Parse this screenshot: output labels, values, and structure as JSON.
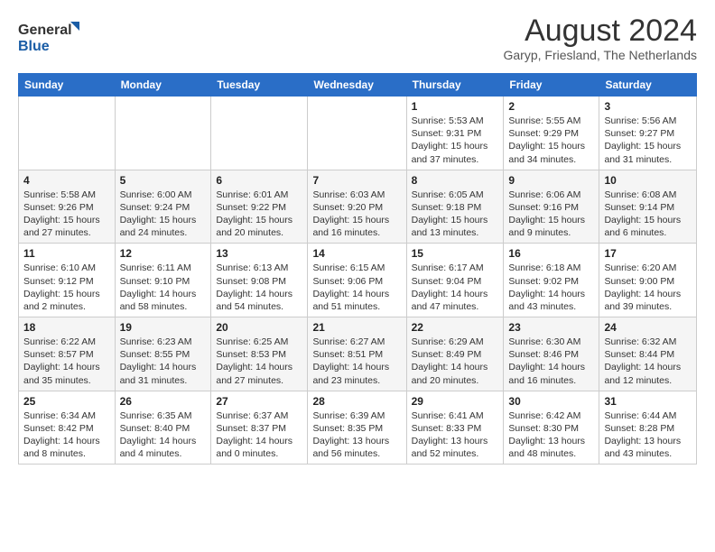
{
  "header": {
    "logo_general": "General",
    "logo_blue": "Blue",
    "main_title": "August 2024",
    "subtitle": "Garyp, Friesland, The Netherlands"
  },
  "weekdays": [
    "Sunday",
    "Monday",
    "Tuesday",
    "Wednesday",
    "Thursday",
    "Friday",
    "Saturday"
  ],
  "weeks": [
    [
      {
        "day": "",
        "info": ""
      },
      {
        "day": "",
        "info": ""
      },
      {
        "day": "",
        "info": ""
      },
      {
        "day": "",
        "info": ""
      },
      {
        "day": "1",
        "info": "Sunrise: 5:53 AM\nSunset: 9:31 PM\nDaylight: 15 hours\nand 37 minutes."
      },
      {
        "day": "2",
        "info": "Sunrise: 5:55 AM\nSunset: 9:29 PM\nDaylight: 15 hours\nand 34 minutes."
      },
      {
        "day": "3",
        "info": "Sunrise: 5:56 AM\nSunset: 9:27 PM\nDaylight: 15 hours\nand 31 minutes."
      }
    ],
    [
      {
        "day": "4",
        "info": "Sunrise: 5:58 AM\nSunset: 9:26 PM\nDaylight: 15 hours\nand 27 minutes."
      },
      {
        "day": "5",
        "info": "Sunrise: 6:00 AM\nSunset: 9:24 PM\nDaylight: 15 hours\nand 24 minutes."
      },
      {
        "day": "6",
        "info": "Sunrise: 6:01 AM\nSunset: 9:22 PM\nDaylight: 15 hours\nand 20 minutes."
      },
      {
        "day": "7",
        "info": "Sunrise: 6:03 AM\nSunset: 9:20 PM\nDaylight: 15 hours\nand 16 minutes."
      },
      {
        "day": "8",
        "info": "Sunrise: 6:05 AM\nSunset: 9:18 PM\nDaylight: 15 hours\nand 13 minutes."
      },
      {
        "day": "9",
        "info": "Sunrise: 6:06 AM\nSunset: 9:16 PM\nDaylight: 15 hours\nand 9 minutes."
      },
      {
        "day": "10",
        "info": "Sunrise: 6:08 AM\nSunset: 9:14 PM\nDaylight: 15 hours\nand 6 minutes."
      }
    ],
    [
      {
        "day": "11",
        "info": "Sunrise: 6:10 AM\nSunset: 9:12 PM\nDaylight: 15 hours\nand 2 minutes."
      },
      {
        "day": "12",
        "info": "Sunrise: 6:11 AM\nSunset: 9:10 PM\nDaylight: 14 hours\nand 58 minutes."
      },
      {
        "day": "13",
        "info": "Sunrise: 6:13 AM\nSunset: 9:08 PM\nDaylight: 14 hours\nand 54 minutes."
      },
      {
        "day": "14",
        "info": "Sunrise: 6:15 AM\nSunset: 9:06 PM\nDaylight: 14 hours\nand 51 minutes."
      },
      {
        "day": "15",
        "info": "Sunrise: 6:17 AM\nSunset: 9:04 PM\nDaylight: 14 hours\nand 47 minutes."
      },
      {
        "day": "16",
        "info": "Sunrise: 6:18 AM\nSunset: 9:02 PM\nDaylight: 14 hours\nand 43 minutes."
      },
      {
        "day": "17",
        "info": "Sunrise: 6:20 AM\nSunset: 9:00 PM\nDaylight: 14 hours\nand 39 minutes."
      }
    ],
    [
      {
        "day": "18",
        "info": "Sunrise: 6:22 AM\nSunset: 8:57 PM\nDaylight: 14 hours\nand 35 minutes."
      },
      {
        "day": "19",
        "info": "Sunrise: 6:23 AM\nSunset: 8:55 PM\nDaylight: 14 hours\nand 31 minutes."
      },
      {
        "day": "20",
        "info": "Sunrise: 6:25 AM\nSunset: 8:53 PM\nDaylight: 14 hours\nand 27 minutes."
      },
      {
        "day": "21",
        "info": "Sunrise: 6:27 AM\nSunset: 8:51 PM\nDaylight: 14 hours\nand 23 minutes."
      },
      {
        "day": "22",
        "info": "Sunrise: 6:29 AM\nSunset: 8:49 PM\nDaylight: 14 hours\nand 20 minutes."
      },
      {
        "day": "23",
        "info": "Sunrise: 6:30 AM\nSunset: 8:46 PM\nDaylight: 14 hours\nand 16 minutes."
      },
      {
        "day": "24",
        "info": "Sunrise: 6:32 AM\nSunset: 8:44 PM\nDaylight: 14 hours\nand 12 minutes."
      }
    ],
    [
      {
        "day": "25",
        "info": "Sunrise: 6:34 AM\nSunset: 8:42 PM\nDaylight: 14 hours\nand 8 minutes."
      },
      {
        "day": "26",
        "info": "Sunrise: 6:35 AM\nSunset: 8:40 PM\nDaylight: 14 hours\nand 4 minutes."
      },
      {
        "day": "27",
        "info": "Sunrise: 6:37 AM\nSunset: 8:37 PM\nDaylight: 14 hours\nand 0 minutes."
      },
      {
        "day": "28",
        "info": "Sunrise: 6:39 AM\nSunset: 8:35 PM\nDaylight: 13 hours\nand 56 minutes."
      },
      {
        "day": "29",
        "info": "Sunrise: 6:41 AM\nSunset: 8:33 PM\nDaylight: 13 hours\nand 52 minutes."
      },
      {
        "day": "30",
        "info": "Sunrise: 6:42 AM\nSunset: 8:30 PM\nDaylight: 13 hours\nand 48 minutes."
      },
      {
        "day": "31",
        "info": "Sunrise: 6:44 AM\nSunset: 8:28 PM\nDaylight: 13 hours\nand 43 minutes."
      }
    ]
  ]
}
